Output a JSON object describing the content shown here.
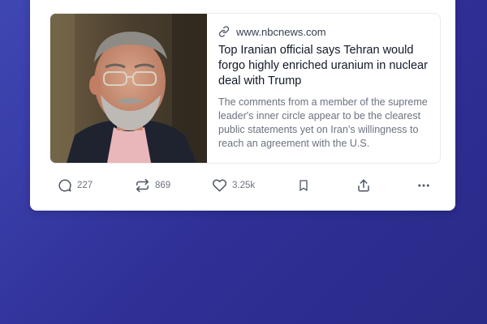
{
  "preview": {
    "source": "www.nbcnews.com",
    "headline": "Top Iranian official says Tehran would forgo highly enriched uranium in nuclear deal with Trump",
    "summary": "The comments from a member of the supreme leader's inner circle appear to be the clearest public statements yet on Iran’s willingness to reach an agreement with the U.S.",
    "image_icon": "news-photo-portrait"
  },
  "actions": {
    "replies": "227",
    "reposts": "869",
    "likes": "3.25k",
    "icons": [
      "reply-icon",
      "repost-icon",
      "heart-icon",
      "bookmark-icon",
      "share-icon",
      "more-icon"
    ]
  },
  "colors": {
    "background": "#3a40a8",
    "card": "#ffffff",
    "headline": "#111827",
    "muted": "#6b7280"
  }
}
